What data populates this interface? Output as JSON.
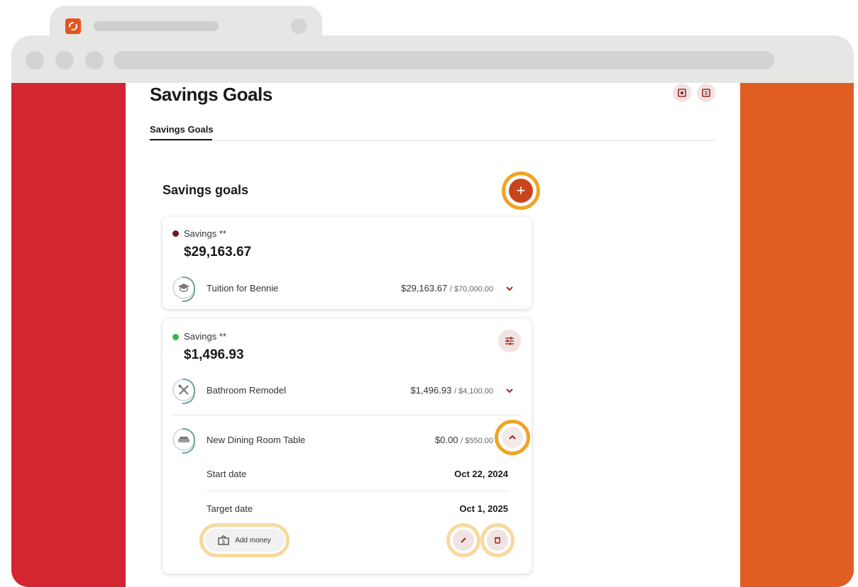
{
  "page": {
    "title": "Savings Goals",
    "tabs": [
      {
        "label": "Savings Goals",
        "active": true
      }
    ]
  },
  "section": {
    "title": "Savings goals"
  },
  "accounts": [
    {
      "label": "Savings **",
      "dot_color": "#6b1b1b",
      "balance": "$29,163.67",
      "goals": [
        {
          "name": "Tuition for Bennie",
          "icon": "graduation-cap-icon",
          "saved": "$29,163.67",
          "target": "/ $70,000.00",
          "expanded": false
        }
      ]
    },
    {
      "label": "Savings **",
      "dot_color": "#3bb54a",
      "balance": "$1,496.93",
      "goals": [
        {
          "name": "Bathroom Remodel",
          "icon": "tools-icon",
          "saved": "$1,496.93",
          "target": "/ $4,100.00",
          "expanded": false
        },
        {
          "name": "New Dining Room Table",
          "icon": "sofa-icon",
          "saved": "$0.00",
          "target": "/ $550.00",
          "expanded": true,
          "details": {
            "start_label": "Start date",
            "start_value": "Oct 22, 2024",
            "target_label": "Target date",
            "target_value": "Oct 1, 2025"
          },
          "add_money_label": "Add money"
        }
      ]
    }
  ],
  "colors": {
    "left_panel": "#d22630",
    "right_panel": "#e05e23",
    "accent": "#c8441b",
    "highlight": "#f0a424",
    "highlight_light": "#f7d9a0"
  }
}
